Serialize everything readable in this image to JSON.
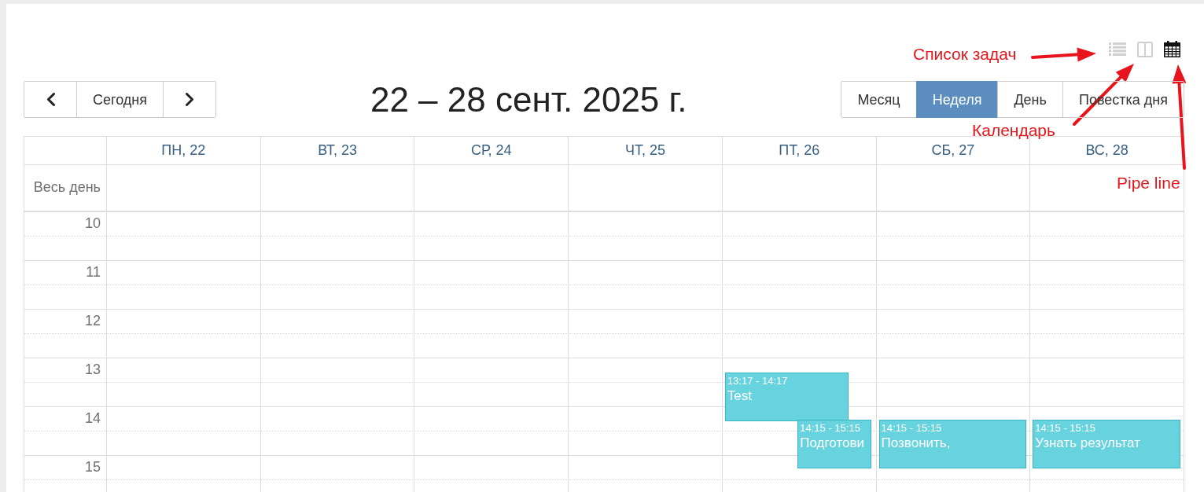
{
  "view_switch": [
    {
      "kind": "list",
      "selected": false,
      "annotation": "Список задач"
    },
    {
      "kind": "columns",
      "selected": false,
      "annotation": "Календарь"
    },
    {
      "kind": "calendar",
      "selected": true,
      "annotation": "Pipe line"
    }
  ],
  "toolbar": {
    "today_button": "Сегодня",
    "title": "22 – 28 сент. 2025 г.",
    "views": [
      {
        "label": "Месяц",
        "selected": false
      },
      {
        "label": "Неделя",
        "selected": true
      },
      {
        "label": "День",
        "selected": false
      },
      {
        "label": "Повестка дня",
        "selected": false
      }
    ]
  },
  "calendar": {
    "all_day_label": "Весь день",
    "days": [
      {
        "label": "ПН, 22"
      },
      {
        "label": "ВТ, 23"
      },
      {
        "label": "СР, 24"
      },
      {
        "label": "ЧТ, 25"
      },
      {
        "label": "ПТ, 26",
        "events": [
          {
            "time": "13:17 - 14:17",
            "title": "Test"
          },
          {
            "time": "14:15 - 15:15",
            "title": "Подготови"
          }
        ]
      },
      {
        "label": "СБ, 27",
        "events": [
          {
            "time": "14:15 - 15:15",
            "title": "Позвонить,"
          }
        ]
      },
      {
        "label": "ВС, 28",
        "events": [
          {
            "time": "14:15 - 15:15",
            "title": "Узнать результат"
          }
        ]
      }
    ],
    "time_slots": [
      "10",
      "11",
      "12",
      "13",
      "14",
      "15"
    ]
  }
}
